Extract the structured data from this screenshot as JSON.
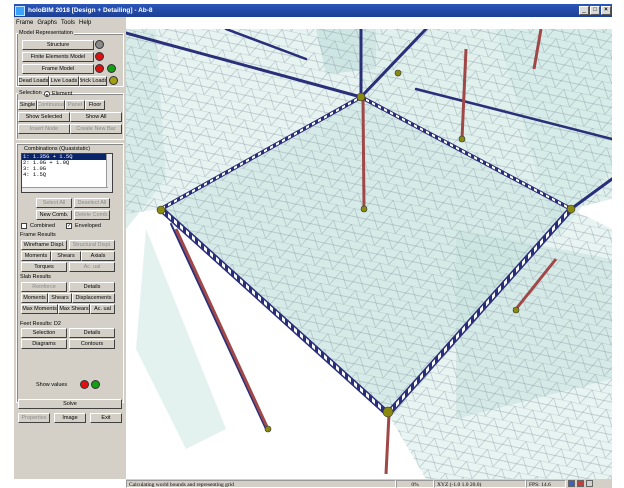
{
  "window": {
    "title": "holoBIM 2018 [Design + Detailing] - Ab-8"
  },
  "menu": [
    "Frame",
    "Graphs",
    "Tools",
    "Help"
  ],
  "model_representation": {
    "label": "Model Representation",
    "structure": "Structure",
    "finite_elements": "Finite Elements Model",
    "frame_model": "Frame Model",
    "dead_loads": "Dead Loads",
    "live_loads": "Live Loads",
    "brick_loads": "Brick Loads"
  },
  "selection": {
    "label": "Selection",
    "element_option": "Element",
    "single": "Single",
    "continuous": "Continuous",
    "panel": "Panel",
    "floor": "Floor",
    "show_selected": "Show Selected",
    "show_all": "Show All",
    "insert_node": "Insert Node",
    "create_new_bar": "Create New Bar"
  },
  "combinations": {
    "label": "Combinations (Quasistatic)",
    "items": [
      "1: 1.35G + 1.5Q",
      "2: 1.0G + 1.0Q",
      "3: 1.0G",
      "4: 1.5Q"
    ],
    "select_all": "Select All",
    "deselect_all": "Deselect All",
    "new_comb": "New Comb.",
    "delete_comb": "Delete Comb.",
    "combined": "Combined",
    "enveloped": "Enveloped"
  },
  "frame_results": {
    "label": "Frame Results",
    "wireframe": "Wireframe Displ.",
    "structural": "Structural Displ.",
    "moments": "Moments",
    "shears": "Shears",
    "axials": "Axials",
    "torques": "Torques",
    "ac_ual": "Ac. ual"
  },
  "slab_results": {
    "label": "Slab Results",
    "reinforce": "Reinforce",
    "details": "Details",
    "moments": "Moments",
    "shears": "Shears",
    "displacements": "Displacements",
    "max_moments": "Max Moments",
    "max_shears": "Max Shears",
    "ac_ual": "Ac. ual"
  },
  "feet_results": {
    "label": "Feet Results: D2",
    "selection": "Selection",
    "details": "Details",
    "diagrams": "Diagrams",
    "contours": "Contours"
  },
  "show_values": "Show values",
  "actions": {
    "solve": "Solve",
    "properties": "Properties",
    "image": "Image",
    "exit": "Exit"
  },
  "status": {
    "message": "Calculating world bounds and representing grid",
    "percent": "0%",
    "coords": "XYZ (-1.0 1.0 20.0)",
    "fps": "FPS: 14.6"
  },
  "colors": {
    "red_dot": "#e01010",
    "green_dot": "#10a010",
    "gray_dot": "#8a8a8a",
    "olive_dot": "#a0a010",
    "beam": "#2a2f7a",
    "column": "#a04848",
    "slab": "#c8e4e0"
  }
}
